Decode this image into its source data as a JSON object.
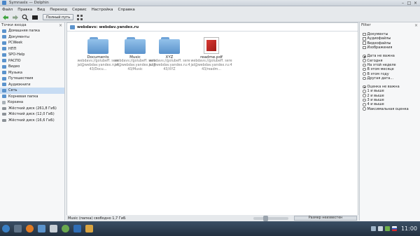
{
  "window": {
    "title": "Symnaslx — Dolphin"
  },
  "menu": [
    "Файл",
    "Правка",
    "Вид",
    "Переход",
    "Сервис",
    "Настройка",
    "Справка"
  ],
  "toolbar": {
    "split_label": "Полный путь"
  },
  "places": {
    "title": "Точки входа",
    "items": [
      {
        "label": "Домашняя папка",
        "kind": "folder"
      },
      {
        "label": "Документы",
        "kind": "folder"
      },
      {
        "label": "PCWeek",
        "kind": "folder"
      },
      {
        "label": "НПП",
        "kind": "folder"
      },
      {
        "label": "SPO-Help",
        "kind": "folder"
      },
      {
        "label": "РАСПО",
        "kind": "folder"
      },
      {
        "label": "Видео",
        "kind": "folder"
      },
      {
        "label": "Музыка",
        "kind": "folder"
      },
      {
        "label": "Путешествия",
        "kind": "folder"
      },
      {
        "label": "Аудиокниги",
        "kind": "folder"
      },
      {
        "label": "Сеть",
        "kind": "folder"
      },
      {
        "label": "Корневая папка",
        "kind": "folder"
      },
      {
        "label": "Корзина",
        "kind": "trash"
      },
      {
        "label": "Жёсткий диск (261,8 ГиБ)",
        "kind": "drive"
      },
      {
        "label": "Жёсткий диск (12,0 ГиБ)",
        "kind": "drive"
      },
      {
        "label": "Жёсткий диск (16,6 ГиБ)",
        "kind": "drive"
      }
    ]
  },
  "location": {
    "path": "webdavs: webdav.yandex.ru"
  },
  "files": [
    {
      "name": "Documents",
      "desc": "webdavs://golubeff. serejal@webdav.yandex.ru:443/Docu...",
      "type": "folder"
    },
    {
      "name": "Music",
      "desc": "webdavs://golubeff. serejal@webdav.yandex.ru:443/Music",
      "type": "folder"
    },
    {
      "name": "XYZ",
      "desc": "webdavs://golubeff. serejal@webdav.yandex.ru:443/XYZ",
      "type": "folder"
    },
    {
      "name": "readme.pdf",
      "desc": "webdavs://golubeff. serejal@webdav.yandex.ru:443/readm...",
      "type": "pdf"
    }
  ],
  "status": {
    "text": "Music (папка) свободно 1,7 ГиБ",
    "size_label": "Размер неизвестен"
  },
  "filter": {
    "title": "Filter",
    "types": [
      "Документы",
      "Аудиофайлы",
      "Видеофайлы",
      "Изображения"
    ],
    "dates": [
      "Дата не важна",
      "Сегодня",
      "На этой неделе",
      "В этом месяце",
      "В этом году",
      "Другая дата..."
    ],
    "ratings": [
      "Оценка не важна",
      "1 и выше",
      "2 и выше",
      "3 и выше",
      "4 и выше",
      "Максимальная оценка"
    ]
  },
  "clock": {
    "time": "11:00",
    "date": ""
  },
  "colors": {
    "accent": "#5b93cc",
    "selection": "#c7dcf3",
    "taskbar": "#2b3a4c"
  }
}
